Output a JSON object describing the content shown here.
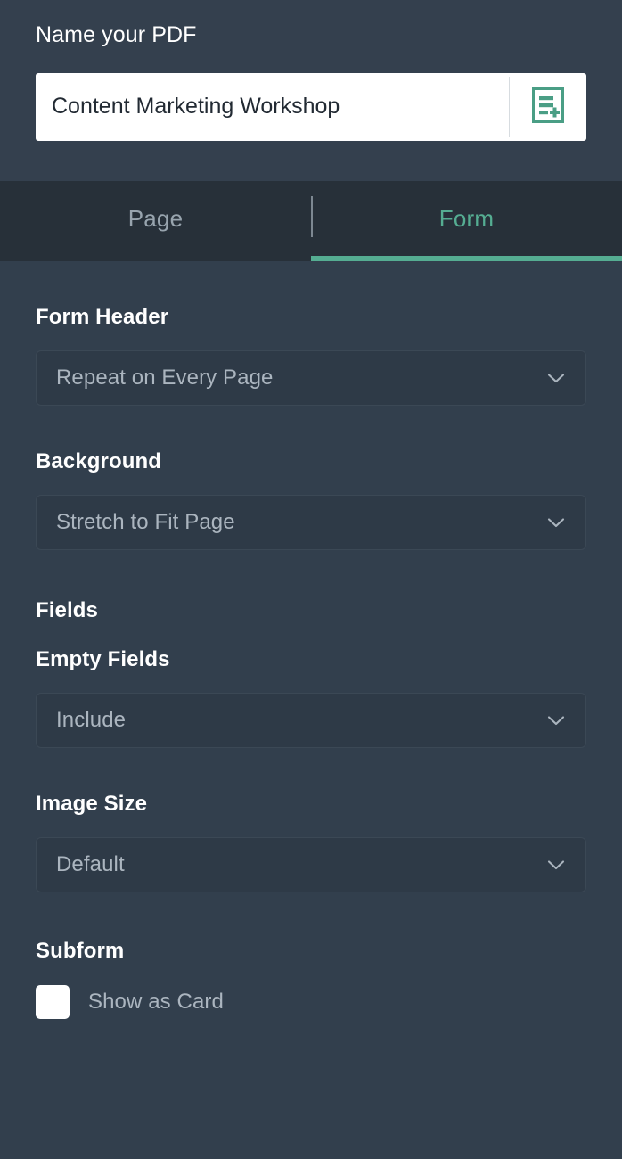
{
  "header": {
    "title": "Name your PDF",
    "pdf_name_value": "Content Marketing Workshop",
    "pdf_name_placeholder": "Name your PDF",
    "new_document_icon": "new-document-icon"
  },
  "tabs": [
    {
      "label": "Page",
      "active": false
    },
    {
      "label": "Form",
      "active": true
    }
  ],
  "settings": {
    "form_header": {
      "label": "Form Header",
      "value": "Repeat on Every Page",
      "chevron_icon": "chevron-down-icon"
    },
    "background": {
      "label": "Background",
      "value": "Stretch to Fit Page",
      "chevron_icon": "chevron-down-icon"
    },
    "fields": {
      "label": "Fields",
      "empty_fields": {
        "label": "Empty Fields",
        "value": "Include",
        "chevron_icon": "chevron-down-icon"
      },
      "image_size": {
        "label": "Image Size",
        "value": "Default",
        "chevron_icon": "chevron-down-icon"
      }
    },
    "subform": {
      "label": "Subform",
      "show_as_card_label": "Show as Card",
      "show_as_card_checked": false
    }
  },
  "colors": {
    "header_bg": "#34404E",
    "tabbar_bg": "#273039",
    "page_bg": "#323F4D",
    "accent_green": "#55ad92",
    "select_bg": "#2E3A47",
    "muted_text": "#abb5bf",
    "inactive_tab_text": "#98a4ae"
  }
}
